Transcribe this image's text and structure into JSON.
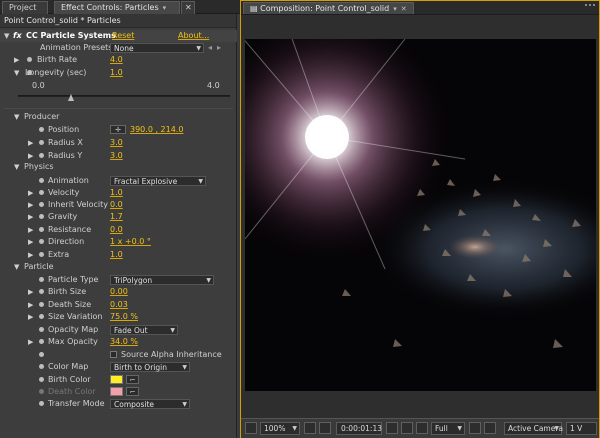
{
  "left_tabs": [
    {
      "label": "Project"
    },
    {
      "label": "Effect Controls: Particles"
    }
  ],
  "header_path": "Point Control_solid * Particles",
  "effect": {
    "name": "CC Particle Systems",
    "reset": "Reset",
    "about": "About...",
    "presets_label": "Animation Presets:",
    "presets_value": "None"
  },
  "birth_rate": {
    "label": "Birth Rate",
    "value": "4.0"
  },
  "longevity": {
    "label": "Longevity (sec)",
    "value": "1.0",
    "min": "0.0",
    "max": "4.0",
    "fraction": 0.25
  },
  "producer": {
    "label": "Producer",
    "position_label": "Position",
    "position_value": "390.0 , 214.0",
    "radius_x_label": "Radius X",
    "radius_x": "3.0",
    "radius_y_label": "Radius Y",
    "radius_y": "3.0"
  },
  "physics": {
    "label": "Physics",
    "animation_label": "Animation",
    "animation_value": "Fractal Explosive",
    "velocity_label": "Velocity",
    "velocity": "1.0",
    "inherit_label": "Inherit Velocity",
    "inherit": "0.0",
    "gravity_label": "Gravity",
    "gravity": "1.7",
    "resistance_label": "Resistance",
    "resistance": "0.0",
    "direction_label": "Direction",
    "direction": "1 x +0.0 °",
    "extra_label": "Extra",
    "extra": "1.0"
  },
  "particle": {
    "label": "Particle",
    "type_label": "Particle Type",
    "type_value": "TriPolygon",
    "birth_size_label": "Birth Size",
    "birth_size": "0.00",
    "death_size_label": "Death Size",
    "death_size": "0.03",
    "size_var_label": "Size Variation",
    "size_var": "75.0 %",
    "opacity_map_label": "Opacity Map",
    "opacity_map": "Fade Out",
    "max_opacity_label": "Max Opacity",
    "max_opacity": "34.0 %",
    "source_alpha_label": "Source Alpha Inheritance",
    "color_map_label": "Color Map",
    "color_map": "Birth to Origin",
    "birth_color_label": "Birth Color",
    "birth_color": "#ffee22",
    "death_color_label": "Death Color",
    "death_color": "#f4a0a8",
    "transfer_label": "Transfer Mode",
    "transfer_value": "Composite"
  },
  "comp": {
    "tab_label": "Composition: Point Control_solid"
  },
  "bottom": {
    "zoom": "100%",
    "timecode": "0:00:01:13",
    "resolution": "Full",
    "camera": "Active Camera",
    "views": "1 V"
  },
  "colors": {
    "accent": "#d4a000",
    "value": "#f2c31c"
  }
}
